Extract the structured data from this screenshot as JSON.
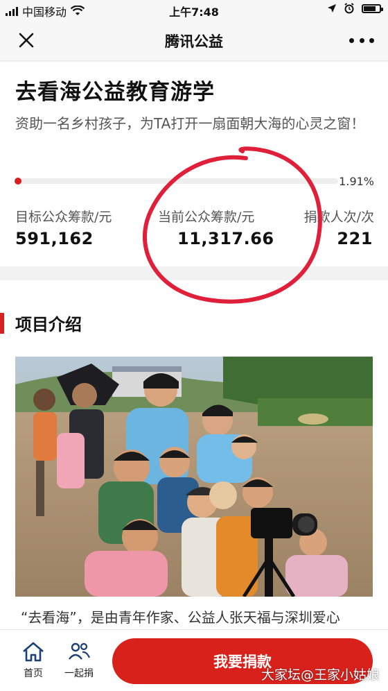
{
  "status_bar": {
    "carrier": "中国移动",
    "time": "上午7:48"
  },
  "navbar": {
    "title": "腾讯公益",
    "close_icon": "close-icon",
    "more_icon": "more-icon"
  },
  "project": {
    "title": "去看海公益教育游学",
    "description": "资助一名乡村孩子，为TA打开一扇面朝大海的心灵之窗！",
    "progress_fraction": 0.0191,
    "progress_label": "1.91%",
    "stats": [
      {
        "label": "目标公众筹款/元",
        "value": "591,162"
      },
      {
        "label": "当前公众筹款/元",
        "value": "11,317.66"
      },
      {
        "label": "捐款人次/次",
        "value": "221"
      }
    ]
  },
  "intro": {
    "section_title": "项目介绍",
    "text": "“去看海”，是由青年作家、公益人张天福与深圳爱心"
  },
  "bottom_bar": {
    "home_label": "首页",
    "together_label": "一起捐",
    "donate_label": "我要捐款"
  },
  "watermark": "大家坛@王家小姑娘",
  "colors": {
    "accent": "#d8201f",
    "annotation_circle": "#e0203a"
  }
}
